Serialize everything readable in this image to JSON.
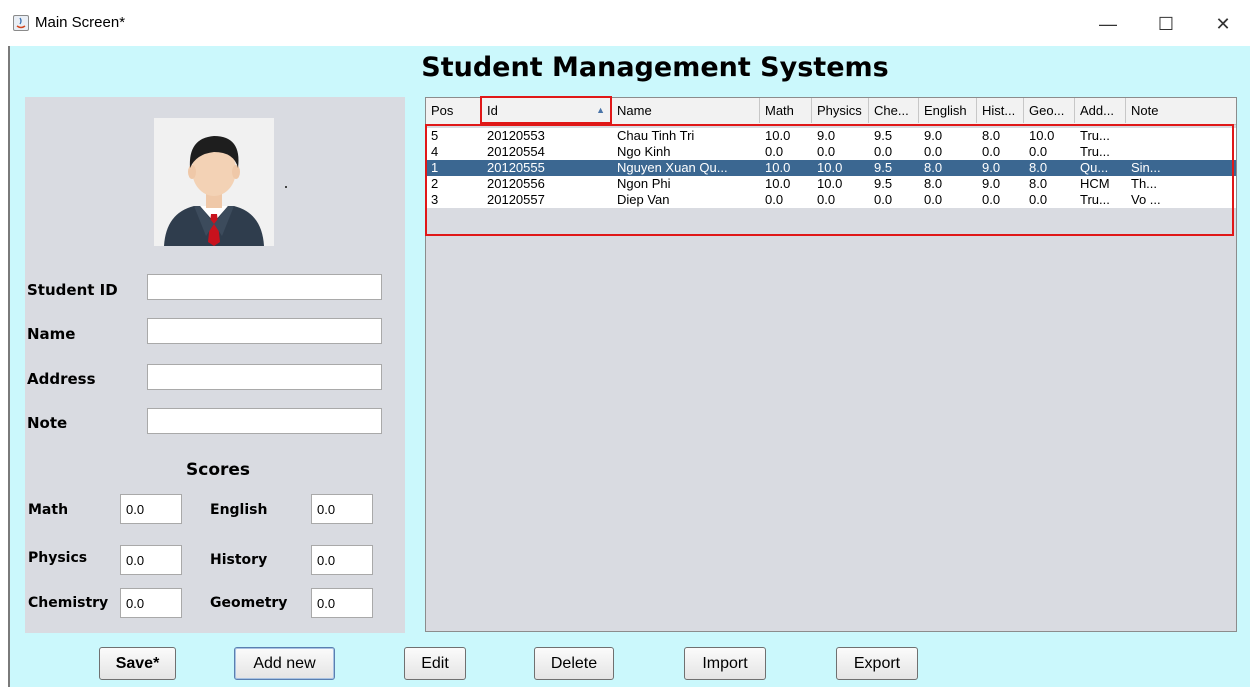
{
  "window": {
    "title": "Main Screen*",
    "controls": [
      "—",
      "☐",
      "✕"
    ]
  },
  "app_title": "Student Management Systems",
  "form": {
    "student_id_label": "Student ID",
    "name_label": "Name",
    "address_label": "Address",
    "note_label": "Note",
    "student_id_value": "",
    "name_value": "",
    "address_value": "",
    "note_value": ""
  },
  "scores": {
    "title": "Scores",
    "math_label": "Math",
    "physics_label": "Physics",
    "chemistry_label": "Chemistry",
    "english_label": "English",
    "history_label": "History",
    "geometry_label": "Geometry",
    "math_value": "0.0",
    "physics_value": "0.0",
    "chemistry_value": "0.0",
    "english_value": "0.0",
    "history_value": "0.0",
    "geometry_value": "0.0"
  },
  "table": {
    "columns": [
      "Pos",
      "Id",
      "Name",
      "Math",
      "Physics",
      "Che...",
      "English",
      "Hist...",
      "Geo...",
      "Add...",
      "Note"
    ],
    "sort_indicator": "▲",
    "rows": [
      [
        "5",
        "20120553",
        "Chau Tinh Tri",
        "10.0",
        "9.0",
        "9.5",
        "9.0",
        "8.0",
        "10.0",
        "Tru...",
        ""
      ],
      [
        "4",
        "20120554",
        "Ngo Kinh",
        "0.0",
        "0.0",
        "0.0",
        "0.0",
        "0.0",
        "0.0",
        "Tru...",
        ""
      ],
      [
        "1",
        "20120555",
        "Nguyen Xuan Qu...",
        "10.0",
        "10.0",
        "9.5",
        "8.0",
        "9.0",
        "8.0",
        "Qu...",
        "Sin..."
      ],
      [
        "2",
        "20120556",
        "Ngon Phi",
        "10.0",
        "10.0",
        "9.5",
        "8.0",
        "9.0",
        "8.0",
        "HCM",
        "Th..."
      ],
      [
        "3",
        "20120557",
        "Diep Van",
        "0.0",
        "0.0",
        "0.0",
        "0.0",
        "0.0",
        "0.0",
        "Tru...",
        "Vo ..."
      ]
    ],
    "selected_row_index": 2
  },
  "buttons": {
    "save": "Save*",
    "add_new": "Add new",
    "edit": "Edit",
    "delete": "Delete",
    "import": "Import",
    "export": "Export"
  },
  "colors": {
    "background": "#cbf8fc",
    "panel": "#d9dbe1",
    "selection": "#3b6791",
    "highlight": "#e01818"
  }
}
